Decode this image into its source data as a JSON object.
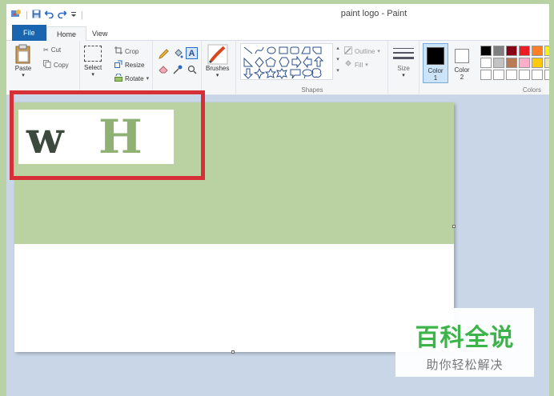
{
  "window": {
    "title": "paint logo - Paint"
  },
  "tabs": [
    {
      "label": "File"
    },
    {
      "label": "Home"
    },
    {
      "label": "View"
    }
  ],
  "clipboard": {
    "paste_label": "Paste",
    "cut_label": "Cut",
    "copy_label": "Copy"
  },
  "image": {
    "select_label": "Select",
    "crop_label": "Crop",
    "resize_label": "Resize",
    "rotate_label": "Rotate"
  },
  "tools": {
    "brushes_label": "Brushes"
  },
  "shapes": {
    "group_label": "Shapes",
    "outline_label": "Outline",
    "fill_label": "Fill"
  },
  "size": {
    "label": "Size"
  },
  "colors": {
    "color1_label": "Color\n1",
    "color1_line1": "Color",
    "color1_line2": "1",
    "color2_line1": "Color",
    "color2_line2": "2",
    "group_label": "Colors",
    "color1_value": "#000000",
    "color2_value": "#ffffff",
    "palette": [
      "#000000",
      "#7f7f7f",
      "#880015",
      "#ed1c24",
      "#ff7f27",
      "#fff200",
      "#ffffff",
      "#c3c3c3",
      "#b97a57",
      "#ffaec9",
      "#ffc90e",
      "#efe4b0",
      "#ffffff",
      "#ffffff",
      "#ffffff",
      "#ffffff",
      "#ffffff",
      "#ffffff"
    ]
  },
  "canvas": {
    "logo_letter_1": "w",
    "logo_letter_2": "H",
    "logo_color_1": "#3b4a3c",
    "logo_color_2": "#8fb173",
    "bg_green": "#bad1a2"
  },
  "watermark": {
    "title": "百科全说",
    "subtitle": "助你轻松解决"
  }
}
